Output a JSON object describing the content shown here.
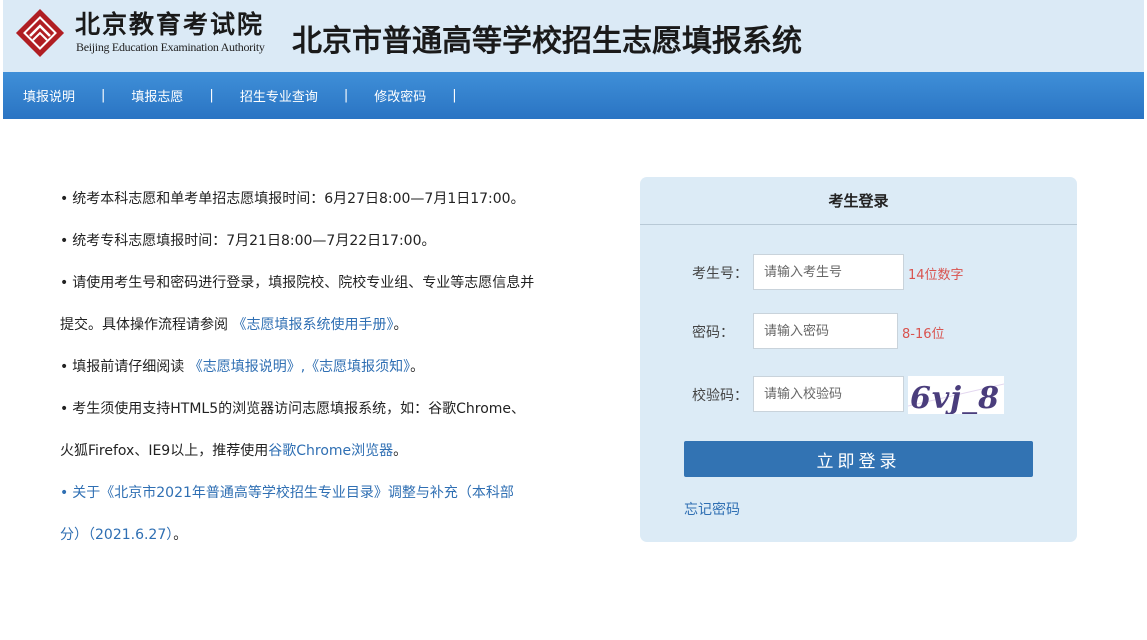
{
  "header": {
    "org_cn": "北京教育考试院",
    "org_en": "Beijing Education Examination Authority",
    "system_title": "北京市普通高等学校招生志愿填报系统"
  },
  "nav": {
    "items": [
      "填报说明",
      "填报志愿",
      "招生专业查询",
      "修改密码"
    ],
    "separator": "|"
  },
  "notices": {
    "bullet": "•",
    "n1": "统考本科志愿和单考单招志愿填报时间：6月27日8:00—7月1日17:00。",
    "n2": "统考专科志愿填报时间：7月21日8:00—7月22日17:00。",
    "n3_line1": "请使用考生号和密码进行登录，填报院校、院校专业组、专业等志愿信息并",
    "n3_line2_prefix": "提交。具体操作流程请参阅 ",
    "n3_link": "《志愿填报系统使用手册》",
    "n3_suffix": "。",
    "n4_prefix": "填报前请仔细阅读 ",
    "n4_link1": "《志愿填报说明》",
    "n4_comma": ",",
    "n4_link2": "《志愿填报须知》",
    "n4_suffix": "。",
    "n5_line1": "考生须使用支持HTML5的浏览器访问志愿填报系统，如：谷歌Chrome、",
    "n5_line2_prefix": "火狐Firefox、IE9以上，推荐使用",
    "n5_link": "谷歌Chrome浏览器",
    "n5_suffix": "。",
    "n6_line1": "关于《北京市2021年普通高等学校招生专业目录》调整与补充（本科部",
    "n6_line2": "分）（2021.6.27）",
    "n6_suffix": "。"
  },
  "login": {
    "title": "考生登录",
    "id_label": "考生号：",
    "id_placeholder": "请输入考生号",
    "id_hint": "14位数字",
    "pwd_label": "密码：",
    "pwd_placeholder": "请输入密码",
    "pwd_hint": "8-16位",
    "captcha_label": "校验码：",
    "captcha_placeholder": "请输入校验码",
    "captcha_text": "6vj_8",
    "submit": "立即登录",
    "forgot": "忘记密码"
  },
  "colors": {
    "header_bg": "#dbeaf6",
    "nav_bg": "#2a74c3",
    "panel_bg": "#dcebf6",
    "button": "#3273b3",
    "link": "#2f6fb3",
    "hint": "#d9534f",
    "logo_red": "#b01e23"
  }
}
